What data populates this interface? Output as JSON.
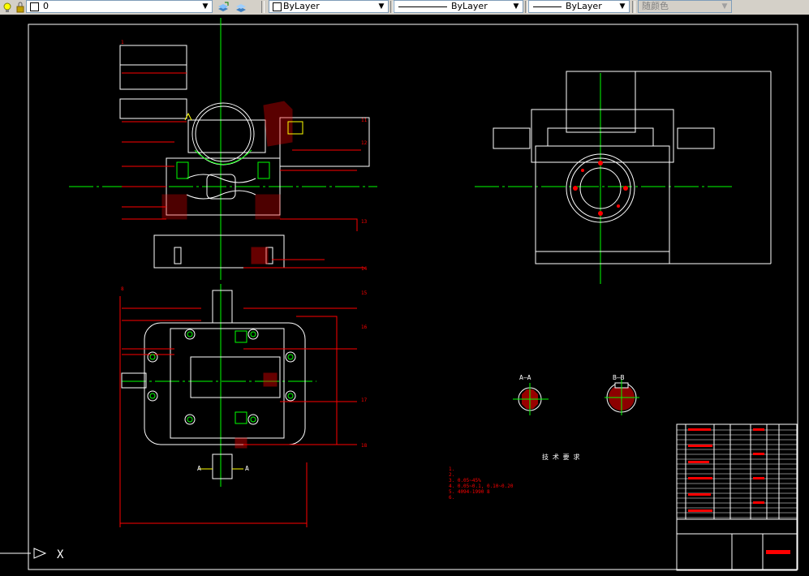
{
  "toolbar": {
    "layer_value": "0",
    "color_value": "ByLayer",
    "linetype_value": "ByLayer",
    "lineweight_value": "ByLayer",
    "plotstyle_value": "随颜色"
  },
  "drawing": {
    "section_aa_label": "A—A",
    "section_bb_label": "B—B",
    "view_a_left": "A",
    "view_a_right": "A",
    "tech_req_title": "技 术 要 求",
    "tech_req_lines": [
      "1. ",
      "2. ",
      "3. 0.05~45%",
      "4. 0.05~0.1, 0.10~0.20",
      "5. 4094-1990 8",
      "6. "
    ],
    "callouts": [
      "11",
      "12",
      "13",
      "14",
      "15",
      "16",
      "17",
      "18",
      "1",
      "8"
    ],
    "ucs_label": "X"
  },
  "colors": {
    "background": "#000000",
    "red": "#ff0000",
    "green": "#00ff00",
    "white": "#ffffff",
    "yellow": "#ffff00"
  }
}
